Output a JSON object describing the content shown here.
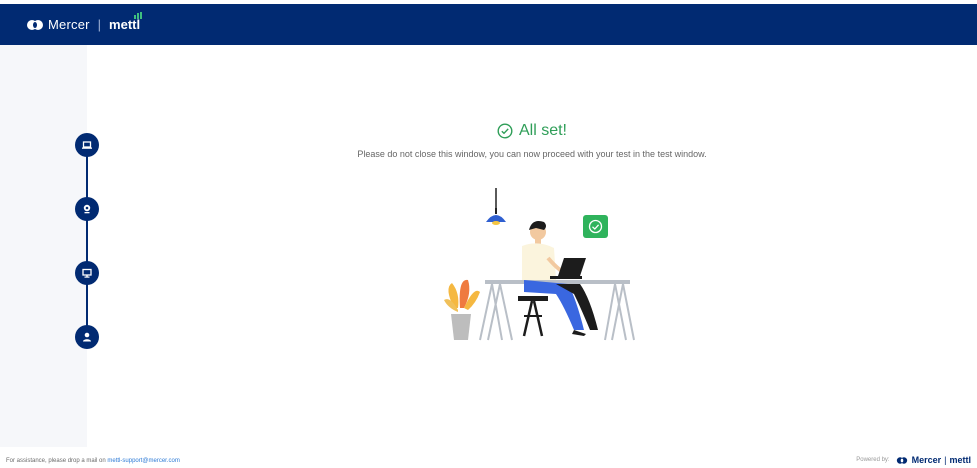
{
  "header": {
    "brand_mercer": "Mercer",
    "brand_separator": "|",
    "brand_mettl": "mettl"
  },
  "sidebar": {
    "steps": [
      {
        "icon": "laptop-icon"
      },
      {
        "icon": "webcam-icon"
      },
      {
        "icon": "monitor-icon"
      },
      {
        "icon": "user-icon"
      }
    ]
  },
  "main": {
    "title": "All set!",
    "message": "Please do not close this window, you can now proceed with your test in the test window."
  },
  "footer": {
    "assistance_text": "For assistance, please drop a mail on",
    "support_email": "mettl-support@mercer.com",
    "powered_by": "Powered by:",
    "powered_mercer": "Mercer",
    "powered_sep": "|",
    "powered_mettl": "mettl"
  },
  "colors": {
    "header_bg": "#012a72",
    "success": "#2f9e58",
    "link": "#2e7bd6"
  }
}
